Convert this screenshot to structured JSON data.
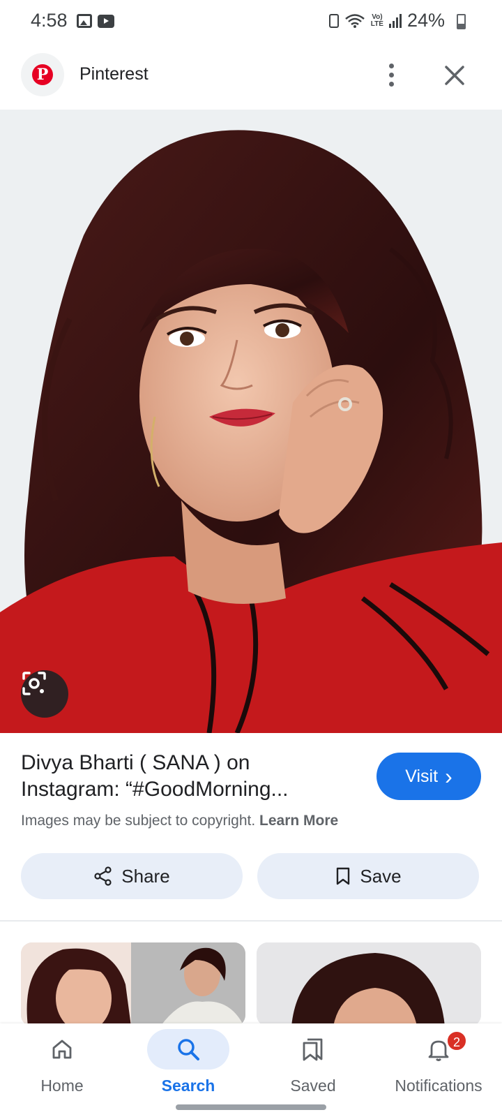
{
  "status_bar": {
    "time": "4:58",
    "battery_text": "24%"
  },
  "header": {
    "site_name": "Pinterest",
    "logo_letter": "P",
    "colors": {
      "brand": "#e60023"
    }
  },
  "result": {
    "title": "Divya Bharti ( SANA ) on Instagram: “#GoodMorning...",
    "visit_label": "Visit",
    "visit_chevron": "›",
    "copyright_text": "Images may be subject to copyright.",
    "learn_more": "Learn More",
    "share_label": "Share",
    "save_label": "Save"
  },
  "bottom_nav": {
    "items": [
      {
        "label": "Home",
        "icon": "home-icon"
      },
      {
        "label": "Search",
        "icon": "search-icon",
        "active": true
      },
      {
        "label": "Saved",
        "icon": "saved-icon"
      },
      {
        "label": "Notifications",
        "icon": "bell-icon",
        "badge": "2"
      }
    ]
  },
  "colors": {
    "accent": "#1a73e8",
    "badge": "#d93025"
  }
}
